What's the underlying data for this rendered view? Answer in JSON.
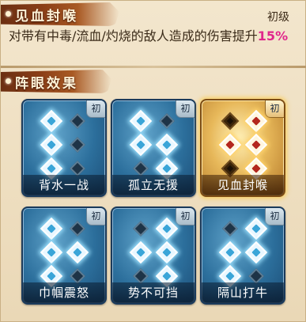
{
  "header": {
    "title": "见血封喉",
    "level": "初级"
  },
  "description": {
    "text": "对带有中毒/流血/灼烧的敌人造成的伤害提升",
    "highlight": "15%"
  },
  "section": {
    "title": "阵眼效果"
  },
  "colors": {
    "highlight": "#e0268c",
    "brush": "#8a3e17",
    "card_blue": "#2c6f9c",
    "card_gold": "#e7b85a"
  },
  "cards": [
    {
      "name": "背水一战",
      "tag": "初",
      "selected": false,
      "icon": "formation-nodes-icon"
    },
    {
      "name": "孤立无援",
      "tag": "初",
      "selected": false,
      "icon": "formation-nodes-icon"
    },
    {
      "name": "见血封喉",
      "tag": "初",
      "selected": true,
      "icon": "formation-nodes-icon"
    },
    {
      "name": "巾帼震怒",
      "tag": "初",
      "selected": false,
      "icon": "formation-nodes-icon"
    },
    {
      "name": "势不可挡",
      "tag": "初",
      "selected": false,
      "icon": "formation-nodes-icon"
    },
    {
      "name": "隔山打牛",
      "tag": "初",
      "selected": false,
      "icon": "formation-nodes-icon"
    }
  ]
}
